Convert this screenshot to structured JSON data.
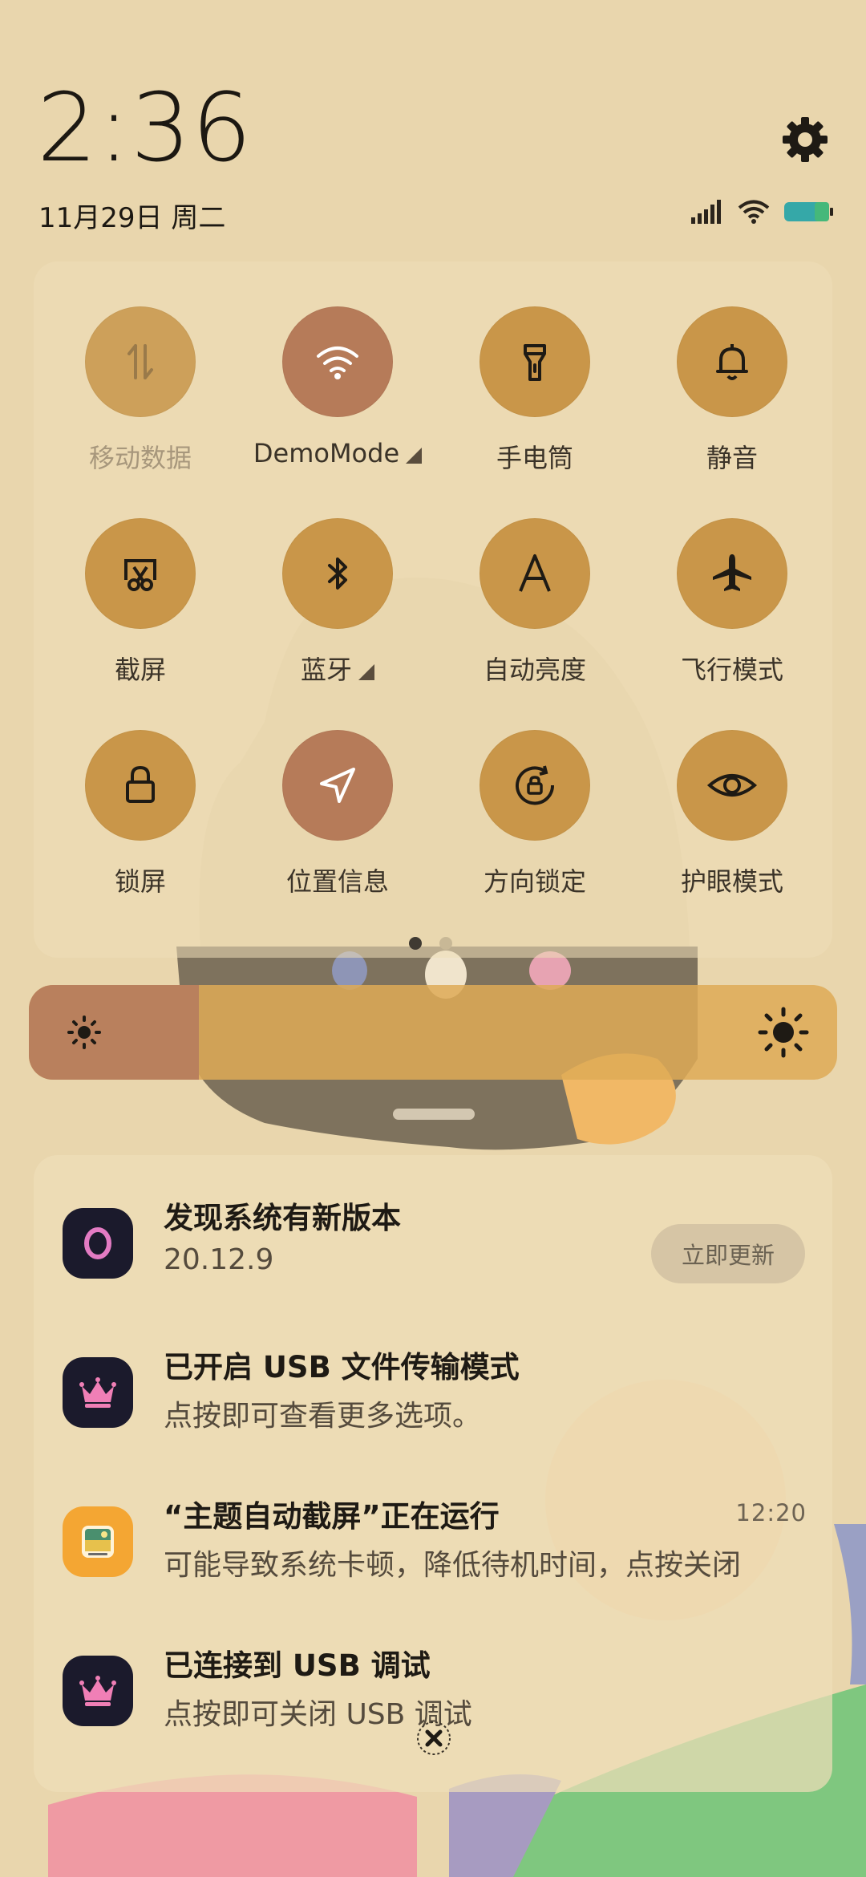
{
  "header": {
    "time": "2:36",
    "date": "11月29日 周二",
    "settings_icon": "gear-icon",
    "status_icons": [
      "signal-icon",
      "wifi-icon",
      "battery-icon"
    ]
  },
  "quick_settings": {
    "tiles": [
      {
        "label": "移动数据",
        "icon": "mobile-data-icon",
        "state": "disabled"
      },
      {
        "label": "DemoMode",
        "icon": "wifi-icon",
        "state": "active",
        "has_more": true
      },
      {
        "label": "手电筒",
        "icon": "flashlight-icon",
        "state": "off"
      },
      {
        "label": "静音",
        "icon": "bell-icon",
        "state": "off"
      },
      {
        "label": "截屏",
        "icon": "screenshot-icon",
        "state": "off"
      },
      {
        "label": "蓝牙",
        "icon": "bluetooth-icon",
        "state": "off",
        "has_more": true
      },
      {
        "label": "自动亮度",
        "icon": "auto-brightness-icon",
        "state": "off"
      },
      {
        "label": "飞行模式",
        "icon": "airplane-icon",
        "state": "off"
      },
      {
        "label": "锁屏",
        "icon": "lock-icon",
        "state": "off"
      },
      {
        "label": "位置信息",
        "icon": "location-icon",
        "state": "active"
      },
      {
        "label": "方向锁定",
        "icon": "rotation-lock-icon",
        "state": "off"
      },
      {
        "label": "护眼模式",
        "icon": "eye-icon",
        "state": "off"
      }
    ],
    "page_count": 2,
    "current_page": 1
  },
  "brightness": {
    "level": 0.21
  },
  "notifications": [
    {
      "title": "发现系统有新版本",
      "text": "20.12.9",
      "action": "立即更新",
      "icon": "system-update-icon",
      "icon_bg": "#1b1a2c"
    },
    {
      "title": "已开启 USB 文件传输模式",
      "text": "点按即可查看更多选项。",
      "icon": "crown-icon",
      "icon_bg": "#1b1a2c"
    },
    {
      "title": "“主题自动截屏”正在运行",
      "text": "可能导致系统卡顿，降低待机时间，点按关闭",
      "time": "12:20",
      "icon": "theme-app-icon",
      "icon_bg": "#f4a633"
    },
    {
      "title": "已连接到 USB 调试",
      "text": "点按即可关闭 USB 调试",
      "icon": "crown-icon",
      "icon_bg": "#1b1a2c"
    }
  ],
  "colors": {
    "tile": "#c99649",
    "tile_active": "#b67b59",
    "panel_bg": "#e9d6ad"
  }
}
